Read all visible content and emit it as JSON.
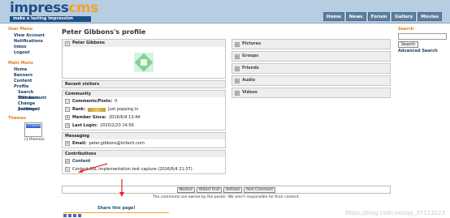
{
  "header": {
    "logo_impress": "impress",
    "logo_cms": "cms",
    "tagline": "make a lasting impression",
    "nav": [
      "Home",
      "News",
      "Forum",
      "Gallery",
      "Movies"
    ]
  },
  "left_sidebar": {
    "user_menu_title": "User Menu",
    "user_menu": [
      "View Account",
      "Notifications",
      "Inbox",
      "Logout"
    ],
    "main_menu_title": "Main Menu",
    "main_menu": [
      "Home",
      "Banners",
      "Content",
      "Profile"
    ],
    "main_menu_sub": [
      "Search Members",
      "Edit account",
      "Change password",
      "Settings"
    ],
    "themes_title": "Themes",
    "theme_option": "iTheme",
    "themes_count": "(1 themes)"
  },
  "profile": {
    "page_title": "Peter Gibbons's profile",
    "user_name": "Peter Gibbons",
    "recent_visitors": "Recent visitors",
    "community_title": "Community",
    "comments_posts_label": "Comments/Posts:",
    "comments_posts_value": "0",
    "rank_label": "Rank:",
    "rank_value": "Just popping in",
    "member_since_label": "Member Since:",
    "member_since_value": "2016/6/4 13:44",
    "last_login_label": "Last Login:",
    "last_login_value": "2020/2/20 14:56",
    "messaging_title": "Messaging",
    "email_label": "Email:",
    "email_value": "peter.gibbons@initech.com",
    "contributions_title": "Contributions",
    "content_label": "Content",
    "content_entry": "Content SSL implementation test capture (2016/6/4 21:37)"
  },
  "links": [
    "Pictures",
    "Groups",
    "Friends",
    "Audio",
    "Videos"
  ],
  "comments": {
    "mode": "Nested",
    "order": "Oldest First",
    "refresh": "Refresh",
    "post": "Post Comment",
    "note": "The comments are owned by the poster. We aren't responsible for their content."
  },
  "share_title": "Share this page!",
  "right_sidebar": {
    "search_title": "Search",
    "search_button": "Search",
    "advanced": "Advanced Search"
  },
  "watermark": "https://blog.csdn.net/qq_37113223",
  "colors": {
    "accent": "#e07d1d",
    "header_bg": "#b7cde1",
    "arrow": "#e5242b"
  }
}
